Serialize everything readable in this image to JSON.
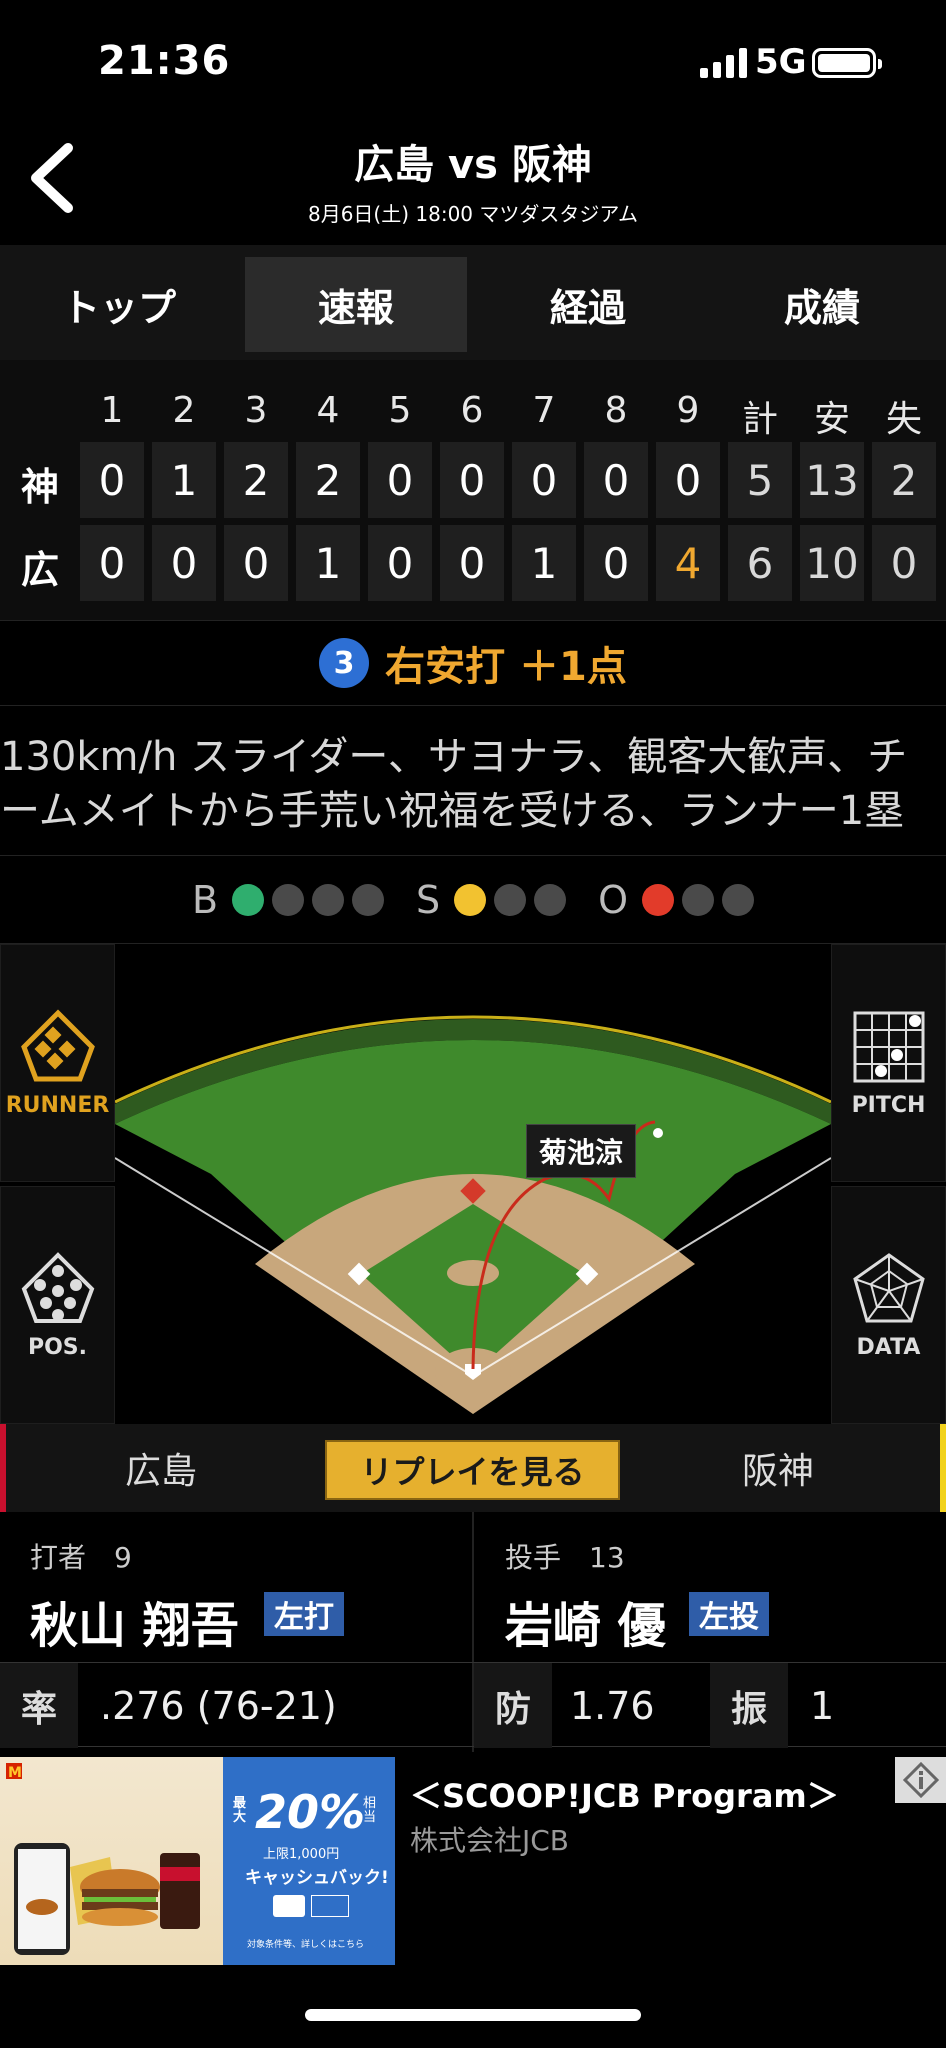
{
  "status": {
    "time": "21:36",
    "network": "5G"
  },
  "header": {
    "title": "広島 vs 阪神",
    "subtitle": "8月6日(土) 18:00 マツダスタジアム"
  },
  "tabs": [
    {
      "label": "トップ",
      "active": false
    },
    {
      "label": "速報",
      "active": true
    },
    {
      "label": "経過",
      "active": false
    },
    {
      "label": "成績",
      "active": false
    }
  ],
  "scoreboard": {
    "columns": [
      "1",
      "2",
      "3",
      "4",
      "5",
      "6",
      "7",
      "8",
      "9",
      "計",
      "安",
      "失"
    ],
    "rows": [
      {
        "team": "神",
        "cells": [
          "0",
          "1",
          "2",
          "2",
          "0",
          "0",
          "0",
          "0",
          "0",
          "5",
          "13",
          "2"
        ]
      },
      {
        "team": "広",
        "cells": [
          "0",
          "0",
          "0",
          "1",
          "0",
          "0",
          "1",
          "0",
          "4",
          "6",
          "10",
          "0"
        ]
      }
    ],
    "highlight_color": "#f0a830"
  },
  "play": {
    "number": "3",
    "text": "右安打 ＋1点"
  },
  "description": {
    "line1": "130km/h スライダー、サヨナラ、観客大歓声、チ",
    "line2": "ームメイトから手荒い祝福を受ける、ランナー1塁"
  },
  "count": {
    "balls_label": "B",
    "balls": 1,
    "balls_max": 4,
    "ball_color": "#2fae6e",
    "strikes_label": "S",
    "strikes": 1,
    "strikes_max": 3,
    "strike_color": "#f2c230",
    "outs_label": "O",
    "outs": 1,
    "outs_max": 3,
    "out_color": "#e23b2a"
  },
  "side_buttons": {
    "runner": "RUNNER",
    "pos": "POS.",
    "pitch": "PITCH",
    "data": "DATA"
  },
  "field": {
    "batter_tag": "菊池涼"
  },
  "teambar": {
    "home": "広島",
    "away": "阪神",
    "replay": "リプレイを見る"
  },
  "batter": {
    "role": "打者",
    "number": "9",
    "name": "秋山 翔吾",
    "hand": "左打"
  },
  "pitcher": {
    "role": "投手",
    "number": "13",
    "name": "岩崎 優",
    "hand": "左投"
  },
  "stats": {
    "batter_key": "率",
    "batter_val": ".276 (76-21)",
    "era_key": "防",
    "era_val": "1.76",
    "so_key": "振",
    "so_val": "1"
  },
  "ad": {
    "headline": "＜SCOOP!JCB Program＞",
    "sponsor": "株式会社JCB",
    "promo_pct": "20%",
    "promo_small": "最大",
    "promo_sub": "相当",
    "promo_cap": "上限1,000円",
    "promo_cash": "キャッシュバック!",
    "promo_note": "対象条件等、詳しくはこちら"
  }
}
